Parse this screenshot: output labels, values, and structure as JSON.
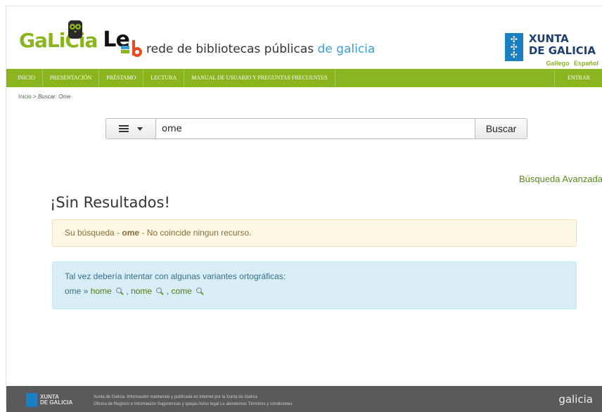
{
  "header": {
    "logo_galicia": "GaLiCia",
    "logo_le": "Le",
    "rede_prefix": "rede de bibliotecas públicas ",
    "rede_suffix": "de galicia",
    "xunta_line1": "XUNTA",
    "xunta_line2": "DE GALICIA",
    "lang_gallego": "Gallego",
    "lang_espanol": "Español"
  },
  "nav": {
    "items": [
      "INICIO",
      "PRESENTACIÓN",
      "PRÉSTAMO",
      "LECTURA",
      "MANUAL DE USUARIO Y PREGUNTAS FRECUENTES"
    ],
    "login": "ENTRAR"
  },
  "breadcrumb": {
    "home": "Inicio",
    "separator": " > ",
    "current": "Buscar: Ome"
  },
  "search": {
    "value": "ome",
    "button": "Buscar"
  },
  "advanced_search": "Búsqueda Avanzada",
  "results": {
    "title": "¡Sin Resultados!",
    "warn_prefix": "Su búsqueda - ",
    "warn_term": "ome",
    "warn_suffix": " - No coincide ningun recurso.",
    "suggestion_intro": "Tal vez debería intentar con algunas variantes ortográficas:",
    "original_term": "ome",
    "arrow": " » ",
    "suggestions": [
      "home",
      "nome",
      "come"
    ],
    "separator": " , "
  },
  "footer": {
    "logo_line1": "XUNTA",
    "logo_line2": "DE GALICIA",
    "line1": "Xunta de Galicia. Información mantenida y publicada en internet por la Xunta de Galicia",
    "line2": "Oficina de Registro e Información  Sugerencias y quejas  Aviso legal  Le atendemos  Términos y condiciones",
    "brand": "galicia"
  },
  "colors": {
    "accent_green": "#8ab51f",
    "link_green": "#4a7d14",
    "xunta_blue": "#1a7fc1"
  }
}
